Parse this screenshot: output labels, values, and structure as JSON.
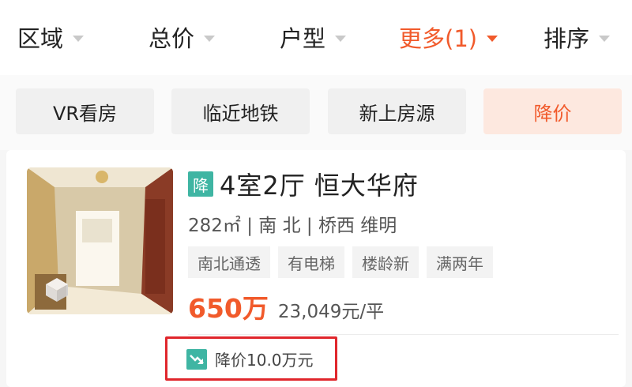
{
  "filters": [
    {
      "label": "区域"
    },
    {
      "label": "总价"
    },
    {
      "label": "户型"
    },
    {
      "label": "更多(1)",
      "active": true
    },
    {
      "label": "排序"
    }
  ],
  "chips": [
    {
      "label": "VR看房"
    },
    {
      "label": "临近地铁"
    },
    {
      "label": "新上房源"
    },
    {
      "label": "降价",
      "active": true
    }
  ],
  "listing": {
    "badge": "降",
    "title": "4室2厅 恒大华府",
    "meta": "282㎡ | 南 北 | 桥西 维明",
    "tags": [
      "南北通透",
      "有电梯",
      "楼龄新",
      "满两年"
    ],
    "price": "650万",
    "unit_price": "23,049元/平",
    "price_drop": "降价10.0万元"
  },
  "colors": {
    "accent": "#f15a2b",
    "badge_green": "#3fb5a3",
    "highlight_red": "#e0262c"
  }
}
